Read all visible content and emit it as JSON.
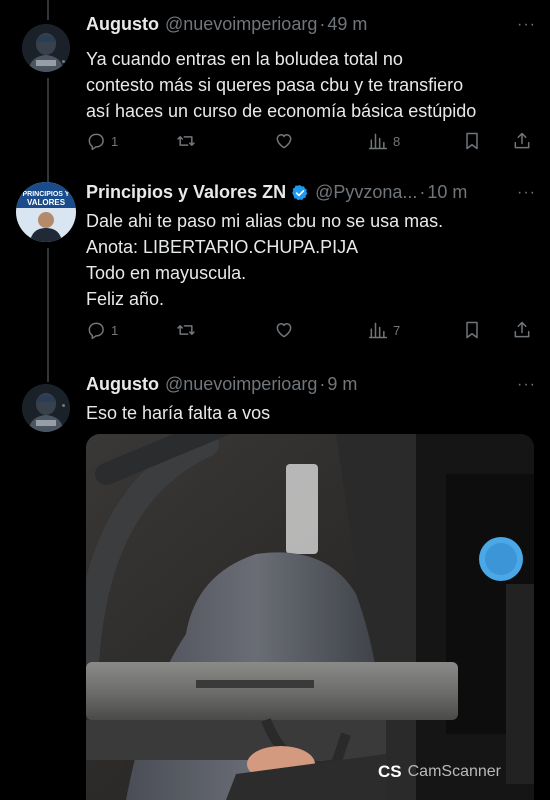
{
  "tweets": [
    {
      "name": "Augusto",
      "handle": "@nuevoimperioarg",
      "separator": "·",
      "time": "49 m",
      "more": "···",
      "lines": [
        "Ya cuando entras en la boludea total no",
        "contesto más si queres pasa cbu y te transfiero",
        "así haces un curso de economía básica estúpido"
      ],
      "replies": "1",
      "views": "8"
    },
    {
      "name": "Principios y Valores ZN",
      "handle": "@Pyvzona...",
      "separator": "·",
      "time": "10 m",
      "more": "···",
      "avatar_text": "PRINCIPIOS Y VALORES",
      "lines": [
        "Dale ahi te paso mi alias cbu no se usa mas.",
        "Anota: LIBERTARIO.CHUPA.PIJA",
        "Todo en mayuscula.",
        "Feliz año."
      ],
      "replies": "1",
      "views": "7"
    },
    {
      "name": "Augusto",
      "handle": "@nuevoimperioarg",
      "separator": "·",
      "time": "9 m",
      "more": "···",
      "lines": [
        "Eso te haría falta a vos"
      ]
    }
  ],
  "watermark": {
    "badge": "CS",
    "text": "CamScanner"
  },
  "colors": {
    "background": "#000000",
    "text": "#e7e9ea",
    "muted": "#71767b",
    "verified": "#1d9bf0"
  },
  "icons": [
    "reply-icon",
    "retweet-icon",
    "like-icon",
    "views-icon",
    "bookmark-icon",
    "share-icon",
    "verified-icon"
  ]
}
